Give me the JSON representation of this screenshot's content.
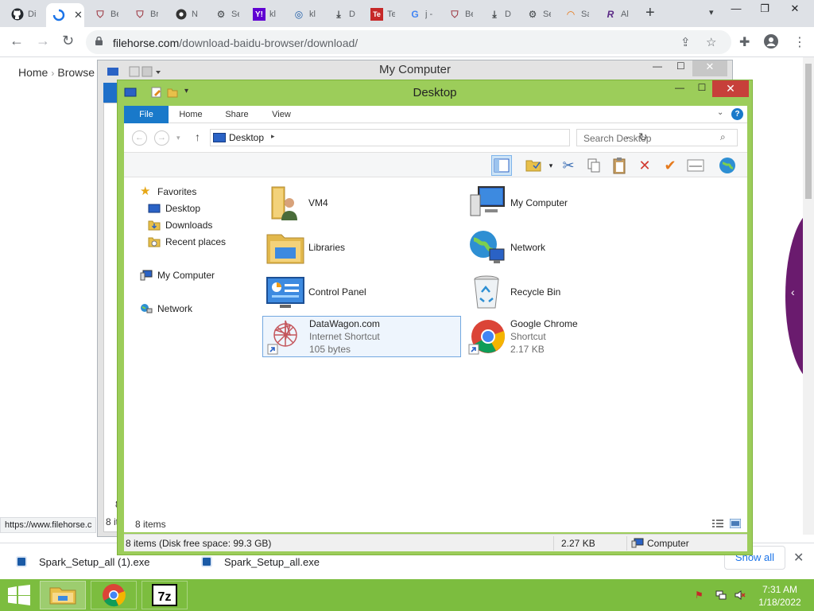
{
  "browser": {
    "tabs": [
      {
        "label": "Di",
        "icon": "github-icon"
      },
      {
        "label": "",
        "icon": "loading-icon"
      },
      {
        "label": "Be",
        "icon": "shield-icon"
      },
      {
        "label": "Br",
        "icon": "shield-icon"
      },
      {
        "label": "N",
        "icon": "chrome-icon"
      },
      {
        "label": "Se",
        "icon": "gear-icon"
      },
      {
        "label": "kl",
        "icon": "yahoo-icon"
      },
      {
        "label": "kl",
        "icon": "globe-icon"
      },
      {
        "label": "D",
        "icon": "download-icon"
      },
      {
        "label": "Te",
        "icon": "te-icon"
      },
      {
        "label": "j -",
        "icon": "google-icon"
      },
      {
        "label": "Be",
        "icon": "shield-icon"
      },
      {
        "label": "D",
        "icon": "download-icon"
      },
      {
        "label": "Se",
        "icon": "gear-icon"
      },
      {
        "label": "Sa",
        "icon": "rainbow-icon"
      },
      {
        "label": "Al",
        "icon": "r-icon"
      }
    ],
    "url_host": "filehorse.com",
    "url_path": "/download-baidu-browser/download/",
    "status_url": "https://www.filehorse.c"
  },
  "webpage": {
    "breadcrumb_home": "Home",
    "breadcrumb_browsers": "Browse"
  },
  "downloads": {
    "items": [
      {
        "label": "Spark_Setup_all (1).exe"
      },
      {
        "label": "Spark_Setup_all.exe"
      }
    ],
    "show_all": "Show all"
  },
  "bg_window": {
    "title": "My Computer",
    "frag_8": "8",
    "frag_8it": "8 it"
  },
  "explorer": {
    "title": "Desktop",
    "ribbon_tabs": {
      "file": "File",
      "home": "Home",
      "share": "Share",
      "view": "View"
    },
    "help": "?",
    "address": "Desktop",
    "search_placeholder": "Search Desktop",
    "nav": {
      "favorites": "Favorites",
      "desktop": "Desktop",
      "downloads": "Downloads",
      "recent": "Recent places",
      "mycomputer": "My Computer",
      "network": "Network"
    },
    "items": [
      {
        "name": "VM4",
        "line2": "",
        "line3": ""
      },
      {
        "name": "My Computer",
        "line2": "",
        "line3": ""
      },
      {
        "name": "Libraries",
        "line2": "",
        "line3": ""
      },
      {
        "name": "Network",
        "line2": "",
        "line3": ""
      },
      {
        "name": "Control Panel",
        "line2": "",
        "line3": ""
      },
      {
        "name": "Recycle Bin",
        "line2": "",
        "line3": ""
      },
      {
        "name": "DataWagon.com",
        "line2": "Internet Shortcut",
        "line3": "105 bytes"
      },
      {
        "name": "Google Chrome",
        "line2": "Shortcut",
        "line3": "2.17 KB"
      }
    ],
    "item_count": "8 items",
    "status_left": "8 items (Disk free space: 99.3 GB)",
    "status_size": "2.27 KB",
    "status_location": "Computer"
  },
  "taskbar": {
    "time": "7:31 AM",
    "date": "1/18/2022"
  },
  "colors": {
    "window_frame": "#9ccd5a",
    "taskbar": "#7cbd3f",
    "file_tab": "#1979ca",
    "close": "#c7403a"
  }
}
